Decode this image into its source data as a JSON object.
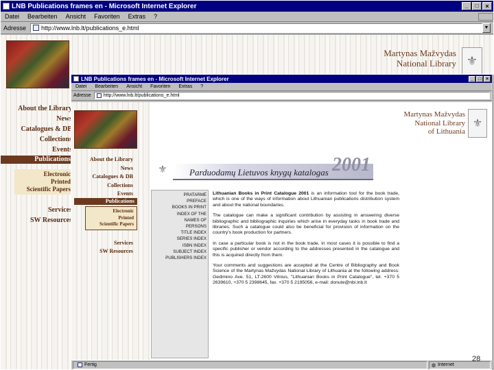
{
  "back_window": {
    "title": "LNB Publications frames en - Microsoft Internet Explorer",
    "menu": [
      "Datei",
      "Bearbeiten",
      "Ansicht",
      "Favoriten",
      "Extras",
      "?"
    ],
    "address_label": "Adresse",
    "address_value": "http://www.lnb.lt/publications_e.html",
    "brand_line1": "Martynas Mažvydas",
    "brand_line2": "National Library",
    "nav": {
      "about": "About the Library",
      "news": "News",
      "catalogues": "Catalogues & DB",
      "collections": "Collections",
      "events": "Events",
      "publications": "Publications",
      "electronic": "Electronic",
      "printed": "Printed",
      "scientific": "Scientific Papers",
      "services": "Services",
      "sw": "SW Resources"
    }
  },
  "front_window": {
    "title": "LNB Publications frames en - Microsoft Internet Explorer",
    "menu": [
      "Datei",
      "Bearbeiten",
      "Ansicht",
      "Favoriten",
      "Extras",
      "?"
    ],
    "address_label": "Adresse",
    "address_value": "http://www.lnb.lt/publications_e.html",
    "brand_line1": "Martynas Mažvydas",
    "brand_line2": "National Library",
    "brand_line3": "of Lithuania",
    "nav": {
      "about": "About the Library",
      "news": "News",
      "catalogues": "Catalogues & DB",
      "collections": "Collections",
      "events": "Events",
      "publications": "Publications",
      "electronic": "Electronic",
      "printed": "Printed",
      "scientific": "Scientific Papers",
      "services": "Services",
      "sw": "SW Resources"
    },
    "banner_title": "Parduodamų Lietuvos knygų katalogas",
    "banner_year": "2001",
    "left_menu": [
      "PRATARMĖ",
      "PREFACE",
      "BOOKS IN PRINT",
      "INDEX OF THE",
      "NAMES OF",
      "PERSONS",
      "TITLE INDEX",
      "SERIES INDEX",
      "ISBN INDEX",
      "SUBJECT INDEX",
      "PUBLISHERS INDEX"
    ],
    "para1_bold": "Lithuanian Books in Print Catalogue 2001",
    "para1_rest": " is an information tool for the book trade, which is one of the ways of information about Lithuanian publications distribution system and about the national boundaries.",
    "para2": "The catalogue can make a significant contribution by assisting in answering diverse bibliographic and bibliographic inquiries which arise in everyday tasks in book trade and libraries. Such a catalogue could also be beneficial for provision of information on the country's book production for partners.",
    "para3": "In case a particular book is not in the book trade, in most cases it is possible to find a specific publisher or vendor according to the addresses presented in the catalogue and this is acquired directly from them.",
    "para4": "Your comments and suggestions are accepted at the Centre of Bibliography and Book Science of the Martynas Mažvydas National Library of Lithuania at the following address: Gedimino Ave. 51, LT-2600 Vilnius, \"Lithuanian Books in Print Catalogue\", tel. +370 5 2639610, +370 5 2398645, fax. +370 5 2195056, e-mail: donute@nbi.lnb.lt",
    "status_left": "Fertig",
    "status_zone": "Internet"
  },
  "slide_number": "28"
}
